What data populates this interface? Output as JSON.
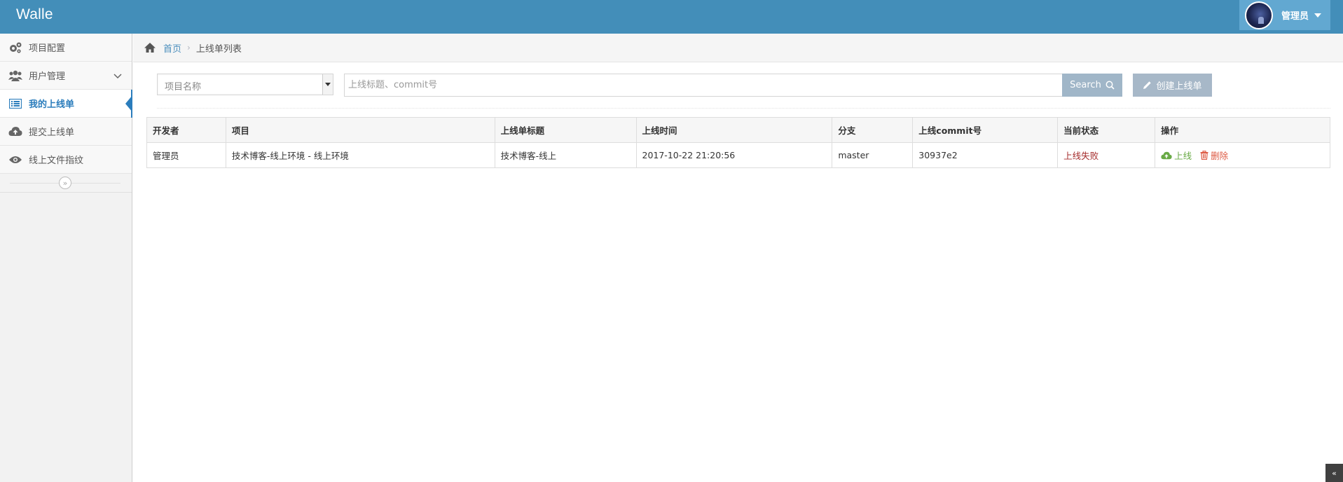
{
  "navbar": {
    "brand": "Walle",
    "user_name": "管理员"
  },
  "sidebar": {
    "items": [
      {
        "label": "项目配置",
        "icon": "cogs-icon"
      },
      {
        "label": "用户管理",
        "icon": "users-icon"
      },
      {
        "label": "我的上线单",
        "icon": "list-icon"
      },
      {
        "label": "提交上线单",
        "icon": "cloud-upload-icon"
      },
      {
        "label": "线上文件指纹",
        "icon": "eye-icon"
      }
    ],
    "collapse_symbol": "»"
  },
  "breadcrumb": {
    "home": "首页",
    "separator": "›",
    "current": "上线单列表"
  },
  "toolbar": {
    "project_placeholder": "项目名称",
    "search_placeholder": "上线标题、commit号",
    "search_label": "Search",
    "create_label": "创建上线单"
  },
  "table": {
    "headers": [
      "开发者",
      "项目",
      "上线单标题",
      "上线时间",
      "分支",
      "上线commit号",
      "当前状态",
      "操作"
    ],
    "rows": [
      {
        "developer": "管理员",
        "project": "技术博客-线上环境 - 线上环境",
        "title": "技术博客-线上",
        "time": "2017-10-22 21:20:56",
        "branch": "master",
        "commit": "30937e2",
        "status": "上线失败",
        "deploy_label": "上线",
        "delete_label": "删除"
      }
    ]
  },
  "scroll_top_symbol": "«",
  "colors": {
    "navbar": "#438eb9",
    "user_menu": "#62a8d1",
    "active_nav": "#2b7dbc",
    "status_fail": "#a42b2b",
    "deploy": "#69aa46",
    "delete": "#dd5a43"
  }
}
